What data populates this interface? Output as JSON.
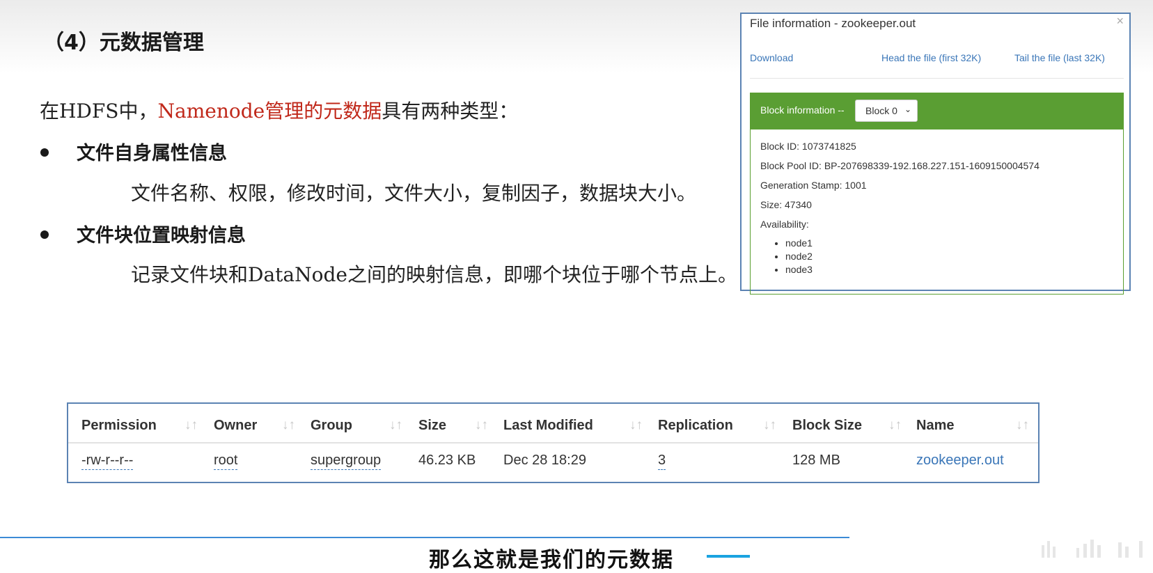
{
  "slide": {
    "title": "（4）元数据管理",
    "intro_prefix": "在",
    "intro_hdfs": "HDFS",
    "intro_mid": "中，",
    "intro_namenode": "Namenode",
    "intro_red": "管理的元数据",
    "intro_suffix": "具有两种类型：",
    "bullets": [
      {
        "heading": "文件自身属性信息",
        "detail": "文件名称、权限，修改时间，文件大小，复制因子，数据块大小。"
      },
      {
        "heading": "文件块位置映射信息",
        "detail_prefix": "记录文件块和",
        "detail_mono": "DataNode",
        "detail_suffix": "之间的映射信息，即哪个块位于哪个节点上。"
      }
    ]
  },
  "modal": {
    "title": "File information - zookeeper.out",
    "close": "×",
    "links": {
      "download": "Download",
      "head": "Head the file (first 32K)",
      "tail": "Tail the file (last 32K)"
    },
    "block_label": "Block information --",
    "block_select": "Block 0",
    "block_id": "Block ID: 1073741825",
    "block_pool": "Block Pool ID: BP-207698339-192.168.227.151-1609150004574",
    "generation": "Generation Stamp: 1001",
    "size": "Size: 47340",
    "availability": "Availability:",
    "nodes": [
      "node1",
      "node2",
      "node3"
    ]
  },
  "table": {
    "headers": {
      "permission": "Permission",
      "owner": "Owner",
      "group": "Group",
      "size": "Size",
      "last_modified": "Last Modified",
      "replication": "Replication",
      "block_size": "Block Size",
      "name": "Name"
    },
    "sort_icon": "↓↑",
    "row": {
      "permission": "-rw-r--r--",
      "owner": "root",
      "group": "supergroup",
      "size": "46.23 KB",
      "last_modified": "Dec 28 18:29",
      "replication": "3",
      "block_size": "128 MB",
      "name": "zookeeper.out"
    }
  },
  "subtitle": "那么这就是我们的元数据",
  "colors": {
    "accent_red": "#c0281a",
    "link_blue": "#3a76b8",
    "block_green": "#5a9e33",
    "frame_blue": "#5b83b3"
  }
}
